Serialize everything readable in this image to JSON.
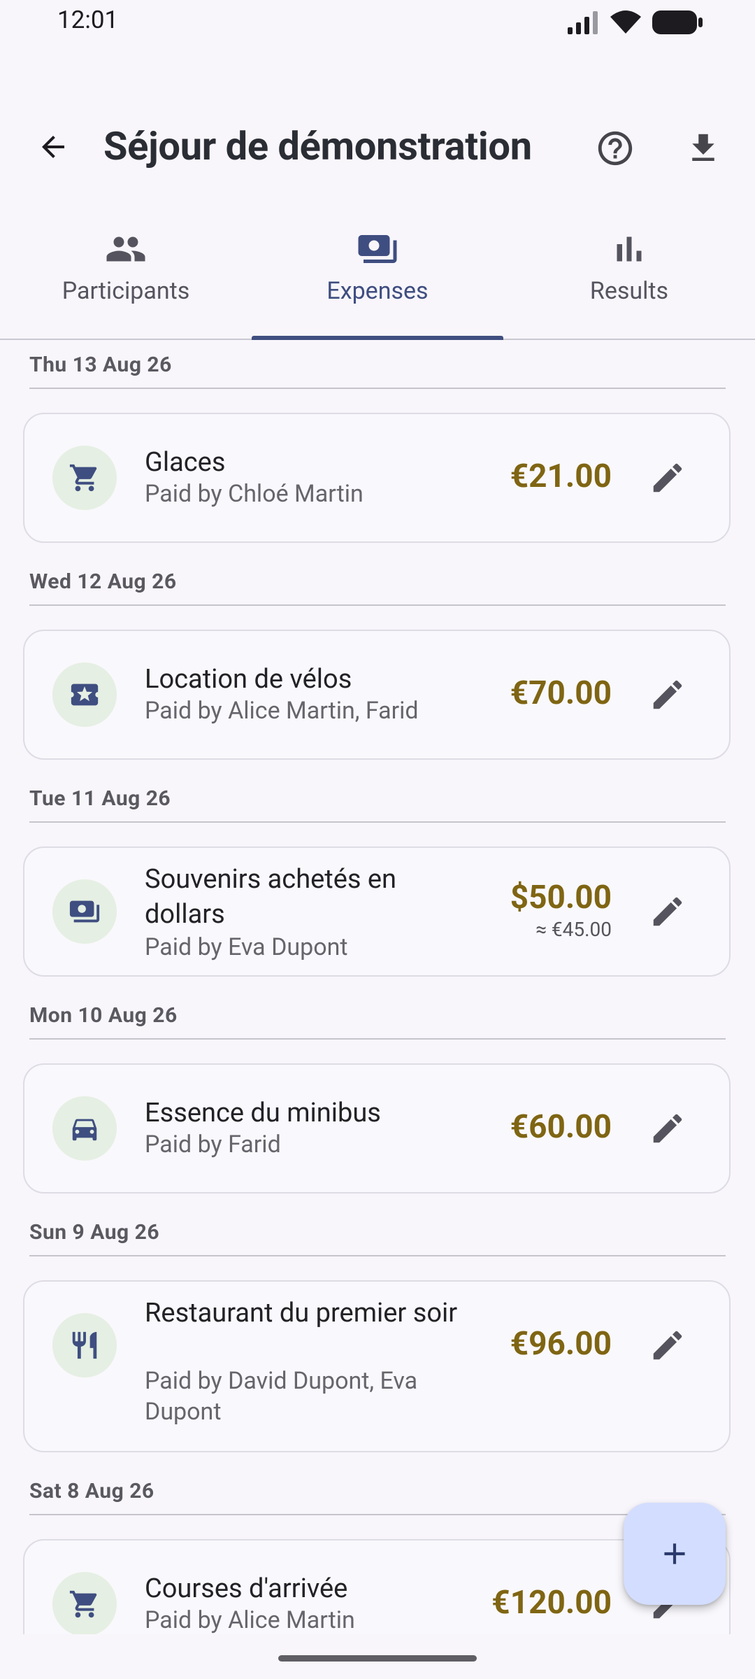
{
  "status": {
    "time": "12:01"
  },
  "header": {
    "title": "Séjour de démonstration"
  },
  "tabs": [
    {
      "label": "Participants",
      "icon": "people-icon"
    },
    {
      "label": "Expenses",
      "icon": "payments-icon",
      "active": true
    },
    {
      "label": "Results",
      "icon": "bar-chart-icon"
    }
  ],
  "groups": [
    {
      "date": "Thu 13 Aug 26",
      "expenses": [
        {
          "title": "Glaces",
          "payer": "Paid by Chloé Martin",
          "amount": "€21.00",
          "icon": "cart-icon"
        }
      ]
    },
    {
      "date": "Wed 12 Aug 26",
      "expenses": [
        {
          "title": "Location de vélos",
          "payer": "Paid by Alice Martin, Farid",
          "amount": "€70.00",
          "icon": "ticket-star-icon"
        }
      ]
    },
    {
      "date": "Tue 11 Aug 26",
      "expenses": [
        {
          "title": "Souvenirs achetés en dollars",
          "payer": "Paid by Eva Dupont",
          "amount": "$50.00",
          "converted": "≈ €45.00",
          "icon": "payments-icon"
        }
      ]
    },
    {
      "date": "Mon 10 Aug 26",
      "expenses": [
        {
          "title": "Essence du minibus",
          "payer": "Paid by Farid",
          "amount": "€60.00",
          "icon": "car-icon"
        }
      ]
    },
    {
      "date": "Sun 9 Aug 26",
      "expenses": [
        {
          "title": "Restaurant du premier soir",
          "payer": "Paid by David Dupont, Eva Dupont",
          "amount": "€96.00",
          "icon": "restaurant-icon"
        }
      ]
    },
    {
      "date": "Sat 8 Aug 26",
      "expenses": [
        {
          "title": "Courses d'arrivée",
          "payer": "Paid by Alice Martin",
          "amount": "€120.00",
          "icon": "cart-icon"
        }
      ]
    }
  ],
  "colors": {
    "accent": "#3f4e80",
    "amount": "#7f6513",
    "icon_circle": "#e5efe3",
    "fab": "#d3ddff"
  }
}
